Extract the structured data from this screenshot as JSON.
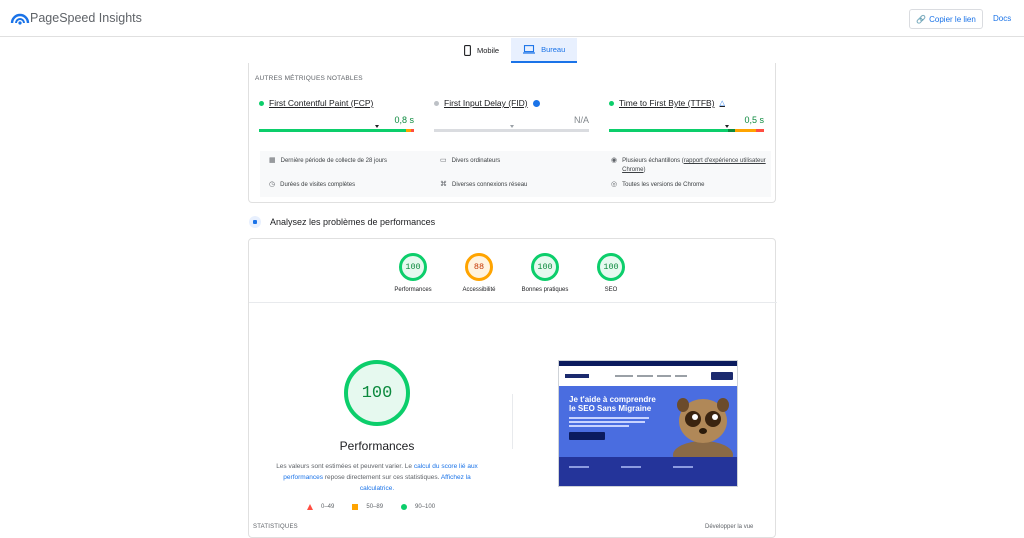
{
  "app": {
    "title": "PageSpeed Insights"
  },
  "header": {
    "copy_link": "Copier le lien",
    "docs": "Docs"
  },
  "tabs": [
    {
      "label": "Mobile",
      "icon": "mobile-icon",
      "active": false
    },
    {
      "label": "Bureau",
      "icon": "laptop-icon",
      "active": true
    }
  ],
  "metrics_section": {
    "title": "AUTRES MÉTRIQUES NOTABLES",
    "metrics": [
      {
        "name": "First Contentful Paint (FCP)",
        "value": "0,8 s",
        "status": "good",
        "marker": 0.76
      },
      {
        "name": "First Input Delay (FID)",
        "value": "N/A",
        "status": "na",
        "marker": 0.5
      },
      {
        "name": "Time to First Byte (TTFB)",
        "value": "0,5 s",
        "status": "good",
        "marker": 0.76
      }
    ],
    "info": {
      "period": "Dernière période de collecte de 28 jours",
      "devices": "Divers ordinateurs",
      "samples_prefix": "Plusieurs échantillons (",
      "samples_link": "rapport d'expérience utilisateur Chrome",
      "samples_suffix": ")",
      "duration": "Durées de visites complètes",
      "network": "Diverses connexions réseau",
      "versions": "Toutes les versions de Chrome"
    }
  },
  "analyze": {
    "label": "Analysez les problèmes de performances"
  },
  "scores": [
    {
      "value": "100",
      "label": "Performances",
      "color": "green"
    },
    {
      "value": "88",
      "label": "Accessibilité",
      "color": "orange"
    },
    {
      "value": "100",
      "label": "Bonnes pratiques",
      "color": "green"
    },
    {
      "value": "100",
      "label": "SEO",
      "color": "green"
    }
  ],
  "performance": {
    "score": "100",
    "title": "Performances",
    "desc_1": "Les valeurs sont estimées et peuvent varier. Le ",
    "desc_link_1": "calcul du score lié aux performances",
    "desc_2": " repose directement sur ces statistiques. ",
    "desc_link_2": "Affichez la calculatrice.",
    "legend": [
      {
        "range": "0–49",
        "color": "#ff4e42"
      },
      {
        "range": "50–89",
        "color": "#ffa400"
      },
      {
        "range": "90–100",
        "color": "#0cce6b"
      }
    ]
  },
  "screenshot": {
    "headline": "Je t'aide à comprendre le SEO Sans Migraine"
  },
  "footer": {
    "left": "STATISTIQUES",
    "right": "Développer la vue"
  },
  "colors": {
    "accent": "#1a73e8",
    "good": "#0cce6b",
    "average": "#ffa400",
    "poor": "#ff4e42"
  }
}
